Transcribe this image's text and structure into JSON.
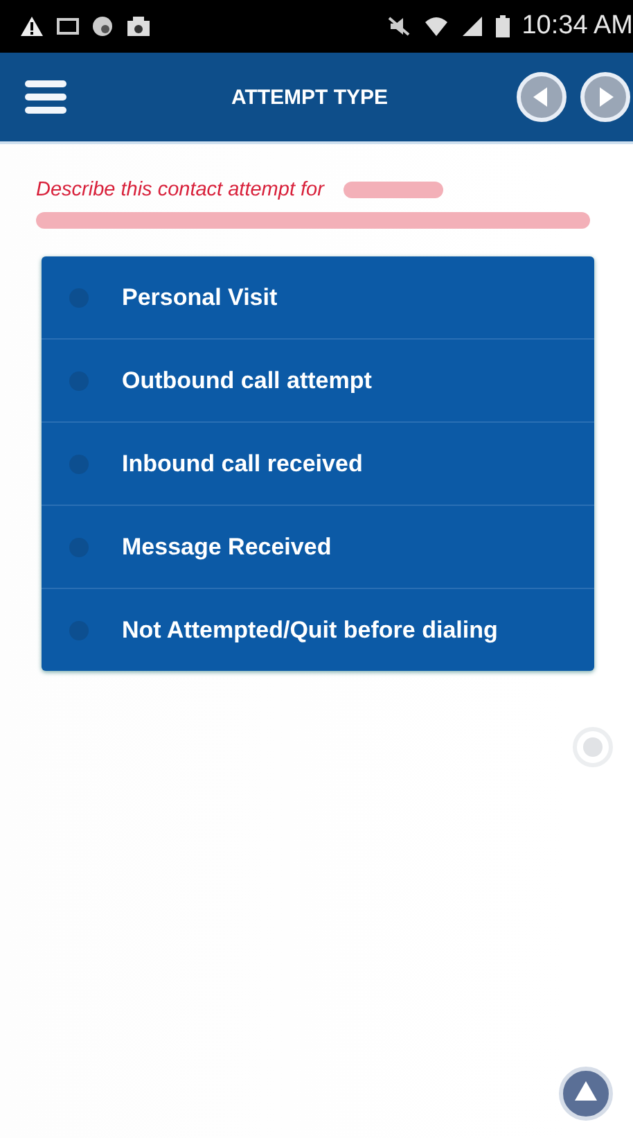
{
  "status_bar": {
    "time": "10:34 AM"
  },
  "header": {
    "title": "ATTEMPT TYPE"
  },
  "prompt": {
    "text": "Describe this contact attempt for"
  },
  "options": [
    {
      "label": "Personal Visit",
      "selected": false
    },
    {
      "label": "Outbound call attempt",
      "selected": false
    },
    {
      "label": "Inbound call received",
      "selected": false
    },
    {
      "label": "Message Received",
      "selected": false
    },
    {
      "label": "Not Attempted/Quit before dialing",
      "selected": false
    }
  ]
}
